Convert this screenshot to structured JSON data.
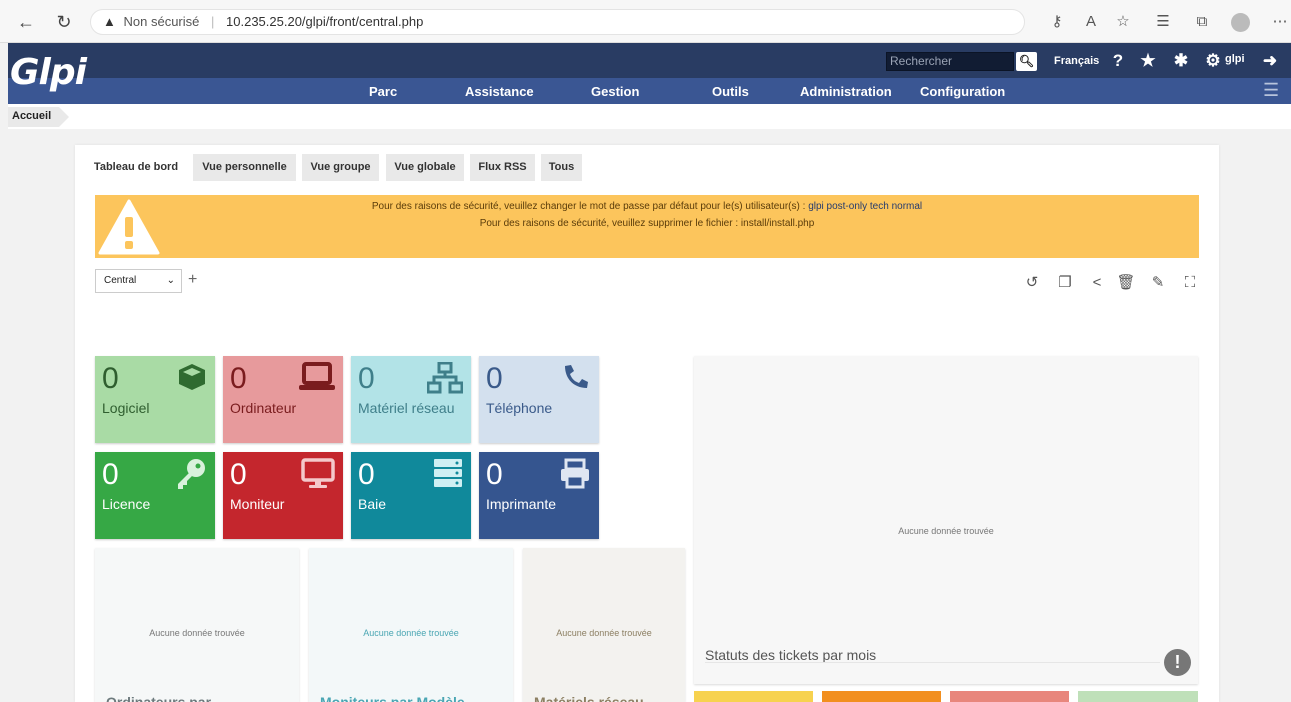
{
  "browser": {
    "security_label": "Non sécurisé",
    "url": "10.235.25.20/glpi/front/central.php"
  },
  "header": {
    "logo": "Glpi",
    "search_placeholder": "Rechercher",
    "language": "Français",
    "user": "glpi"
  },
  "menu": {
    "items": [
      "Parc",
      "Assistance",
      "Gestion",
      "Outils",
      "Administration",
      "Configuration"
    ]
  },
  "breadcrumb": {
    "label": "Accueil"
  },
  "tabs": [
    "Tableau de bord",
    "Vue personnelle",
    "Vue groupe",
    "Vue globale",
    "Flux RSS",
    "Tous"
  ],
  "alert": {
    "line1_text": "Pour des raisons de sécurité, veuillez changer le mot de passe par défaut pour le(s) utilisateur(s) :",
    "line1_users": "glpi post-only tech normal",
    "line2_text": "Pour des raisons de sécurité, veuillez supprimer le fichier : install/install.php"
  },
  "dashboard_select": {
    "value": "Central"
  },
  "cards": [
    {
      "value": "0",
      "label": "Logiciel",
      "icon": "box-icon",
      "bg": "#a9dba5",
      "fg": "#2f5e2f"
    },
    {
      "value": "0",
      "label": "Ordinateur",
      "icon": "laptop-icon",
      "bg": "#e79a9c",
      "fg": "#7a1c1e"
    },
    {
      "value": "0",
      "label": "Matériel réseau",
      "icon": "network-icon",
      "bg": "#b2e3e7",
      "fg": "#3f7f8a"
    },
    {
      "value": "0",
      "label": "Téléphone",
      "icon": "phone-icon",
      "bg": "#d3e0ee",
      "fg": "#3a5a8a"
    },
    {
      "value": "0",
      "label": "Licence",
      "icon": "key-icon",
      "bg": "#36a845",
      "fg": "#ffffff"
    },
    {
      "value": "0",
      "label": "Moniteur",
      "icon": "monitor-icon",
      "bg": "#c4262d",
      "fg": "#ffffff"
    },
    {
      "value": "0",
      "label": "Baie",
      "icon": "server-icon",
      "bg": "#10899b",
      "fg": "#ffffff"
    },
    {
      "value": "0",
      "label": "Imprimante",
      "icon": "printer-icon",
      "bg": "#35558f",
      "fg": "#ffffff"
    }
  ],
  "widgets": {
    "no_data": "Aucune donnée trouvée",
    "computers_title": "Ordinateurs par",
    "monitors_title": "Moniteurs par Modèle",
    "network_title": "Matériels réseau",
    "tickets_title": "Statuts des tickets par mois"
  },
  "colors": {
    "header_dark": "#293c63",
    "header_nav": "#3a5693",
    "alert": "#fcc55c"
  }
}
